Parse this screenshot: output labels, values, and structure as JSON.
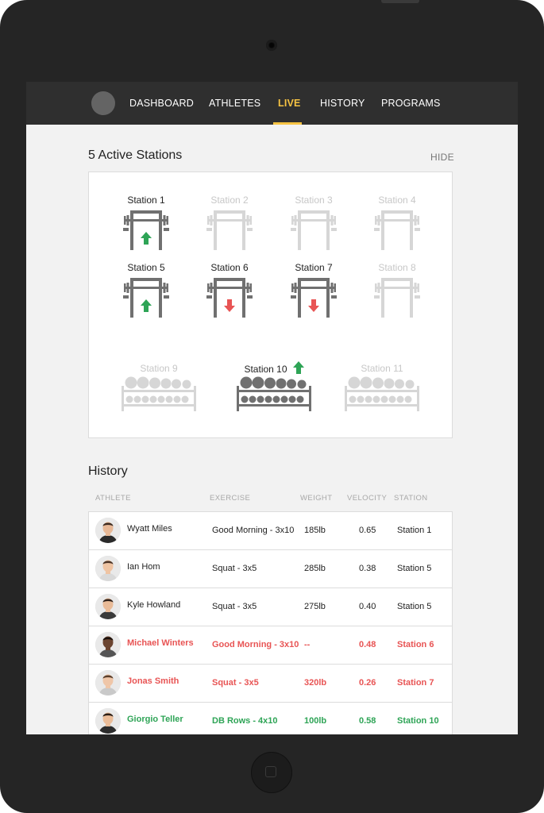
{
  "nav": {
    "items": [
      {
        "label": "DASHBOARD",
        "active": false
      },
      {
        "label": "ATHLETES",
        "active": false
      },
      {
        "label": "LIVE",
        "active": true
      },
      {
        "label": "HISTORY",
        "active": false
      },
      {
        "label": "PROGRAMS",
        "active": false
      }
    ]
  },
  "stations_section": {
    "title": "5 Active Stations",
    "hide_label": "HIDE",
    "stations": [
      {
        "label": "Station 1",
        "type": "rack",
        "active": true,
        "arrow": "up"
      },
      {
        "label": "Station 2",
        "type": "rack",
        "active": false,
        "arrow": null
      },
      {
        "label": "Station 3",
        "type": "rack",
        "active": false,
        "arrow": null
      },
      {
        "label": "Station 4",
        "type": "rack",
        "active": false,
        "arrow": null
      },
      {
        "label": "Station 5",
        "type": "rack",
        "active": true,
        "arrow": "up"
      },
      {
        "label": "Station 6",
        "type": "rack",
        "active": true,
        "arrow": "down"
      },
      {
        "label": "Station 7",
        "type": "rack",
        "active": true,
        "arrow": "down"
      },
      {
        "label": "Station 8",
        "type": "rack",
        "active": false,
        "arrow": null
      },
      {
        "label": "Station 9",
        "type": "dumbbell",
        "active": false,
        "arrow": null
      },
      {
        "label": "Station 10",
        "type": "dumbbell",
        "active": true,
        "arrow": "up"
      },
      {
        "label": "Station 11",
        "type": "dumbbell",
        "active": false,
        "arrow": null
      }
    ]
  },
  "history": {
    "title": "History",
    "columns": {
      "athlete": "ATHLETE",
      "exercise": "EXERCISE",
      "weight": "WEIGHT",
      "velocity": "VELOCITY",
      "station": "STATION"
    },
    "rows": [
      {
        "athlete": "Wyatt Miles",
        "exercise": "Good Morning - 3x10",
        "weight": "185lb",
        "velocity": "0.65",
        "station": "Station 1",
        "status": "normal"
      },
      {
        "athlete": "Ian Hom",
        "exercise": "Squat - 3x5",
        "weight": "285lb",
        "velocity": "0.38",
        "station": "Station 5",
        "status": "normal"
      },
      {
        "athlete": "Kyle Howland",
        "exercise": "Squat - 3x5",
        "weight": "275lb",
        "velocity": "0.40",
        "station": "Station 5",
        "status": "normal"
      },
      {
        "athlete": "Michael Winters",
        "exercise": "Good Morning - 3x10",
        "weight": "--",
        "velocity": "0.48",
        "station": "Station 6",
        "status": "red"
      },
      {
        "athlete": "Jonas Smith",
        "exercise": "Squat - 3x5",
        "weight": "320lb",
        "velocity": "0.26",
        "station": "Station 7",
        "status": "red"
      },
      {
        "athlete": "Giorgio Teller",
        "exercise": "DB Rows - 4x10",
        "weight": "100lb",
        "velocity": "0.58",
        "station": "Station 10",
        "status": "green"
      }
    ]
  },
  "colors": {
    "accent": "#f6c343",
    "up": "#2ea456",
    "down": "#e85454",
    "equipment_active": "#707070",
    "equipment_inactive": "#d6d6d6"
  }
}
